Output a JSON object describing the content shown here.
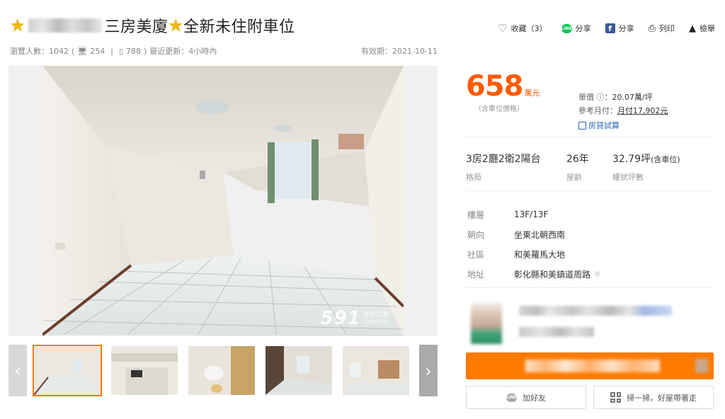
{
  "title": {
    "text": "三房美廈",
    "tail": "全新未住附車位",
    "star_icon": "star-icon"
  },
  "stats": {
    "views": "瀏覽人數：1042",
    "pc_count": "254",
    "mobile_count": "788",
    "updated": "最近更新：4小時內",
    "open_paren": "(",
    "close_paren": ")",
    "divider": "|"
  },
  "expire": "有效期：2021-10-11",
  "actions": {
    "favorite": "收藏（3）",
    "line_share": "分享",
    "fb_share": "分享",
    "print": "列印",
    "report": "檢舉"
  },
  "watermark": {
    "brand": "591",
    "sub1": "房屋交易",
    "sub2": ".com.tw"
  },
  "price": {
    "value": "658",
    "unit": "萬元",
    "note": "（含車位價格）"
  },
  "unit_info": {
    "unit_price_label": "單價 ⓘ：",
    "unit_price": "20.07萬/坪",
    "monthly_label": "參考月付：",
    "monthly": "月付17,902元",
    "loan_link": "房貸試算"
  },
  "facts": [
    {
      "value": "3房2廳2衛2陽台",
      "label": "格局"
    },
    {
      "value": "26年",
      "label": "屋齡"
    },
    {
      "value": "32.79坪",
      "suffix": "(含車位)",
      "label": "權狀坪數"
    }
  ],
  "details": [
    {
      "key": "樓層",
      "value": "13F/13F"
    },
    {
      "key": "朝向",
      "value": "坐東北朝西南"
    },
    {
      "key": "社區",
      "value": "和美羅馬大地"
    },
    {
      "key": "地址",
      "value": "彰化縣和美鎮道周路"
    }
  ],
  "buttons": {
    "add_friend": "加好友",
    "scan": "掃一掃，好屋帶著走"
  },
  "nav": {
    "prev": "‹",
    "next": "›"
  },
  "colors": {
    "accent": "#ff7a00",
    "price": "#ff5a00",
    "link": "#2766b8",
    "line": "#06c755",
    "facebook": "#3b5998"
  }
}
